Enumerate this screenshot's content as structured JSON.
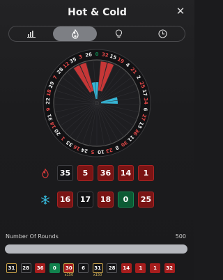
{
  "header": {
    "title": "Hot & Cold",
    "close_icon": "close-icon"
  },
  "tabs": [
    {
      "name": "stats",
      "icon": "bar-chart-icon",
      "active": false
    },
    {
      "name": "hot-cold",
      "icon": "fire-ice-icon",
      "active": true
    },
    {
      "name": "tips",
      "icon": "lightbulb-icon",
      "active": false
    },
    {
      "name": "history",
      "icon": "clock-icon",
      "active": false
    }
  ],
  "wheel": {
    "numbers": [
      "0",
      "32",
      "15",
      "19",
      "4",
      "21",
      "2",
      "25",
      "17",
      "34",
      "6",
      "27",
      "13",
      "36",
      "11",
      "30",
      "8",
      "23",
      "10",
      "5",
      "24",
      "16",
      "33",
      "1",
      "20",
      "14",
      "31",
      "9",
      "22",
      "18",
      "29",
      "7",
      "28",
      "12",
      "35",
      "3",
      "26"
    ],
    "hot": [
      "32",
      "15",
      "35",
      "3"
    ],
    "cold": [
      "17",
      "34",
      "26",
      "0"
    ]
  },
  "hot": {
    "icon": "fire-icon",
    "numbers": [
      {
        "n": "35",
        "c": "black"
      },
      {
        "n": "5",
        "c": "red"
      },
      {
        "n": "36",
        "c": "red"
      },
      {
        "n": "14",
        "c": "red"
      },
      {
        "n": "1",
        "c": "red"
      }
    ]
  },
  "cold": {
    "icon": "snowflake-icon",
    "numbers": [
      {
        "n": "16",
        "c": "red"
      },
      {
        "n": "17",
        "c": "black"
      },
      {
        "n": "18",
        "c": "red"
      },
      {
        "n": "0",
        "c": "green"
      },
      {
        "n": "25",
        "c": "red"
      }
    ]
  },
  "rounds": {
    "label": "Number Of Rounds",
    "value": "500"
  },
  "history": [
    {
      "n": "31",
      "c": "black",
      "outlined": true,
      "mult": ""
    },
    {
      "n": "28",
      "c": "black",
      "outlined": false,
      "mult": ""
    },
    {
      "n": "36",
      "c": "red",
      "outlined": false,
      "mult": ""
    },
    {
      "n": "0",
      "c": "green",
      "outlined": false,
      "mult": ""
    },
    {
      "n": "30",
      "c": "red",
      "outlined": true,
      "mult": "x150"
    },
    {
      "n": "6",
      "c": "black",
      "outlined": false,
      "mult": ""
    },
    {
      "n": "31",
      "c": "black",
      "outlined": true,
      "mult": "x150"
    },
    {
      "n": "28",
      "c": "black",
      "outlined": false,
      "mult": ""
    },
    {
      "n": "14",
      "c": "red",
      "outlined": false,
      "mult": ""
    },
    {
      "n": "1",
      "c": "red",
      "outlined": false,
      "mult": ""
    },
    {
      "n": "1",
      "c": "red",
      "outlined": false,
      "mult": ""
    },
    {
      "n": "32",
      "c": "red",
      "outlined": false,
      "mult": ""
    }
  ],
  "colors": {
    "hot": "#d83a3a",
    "cold": "#38c4e8",
    "red": "#a61d1d",
    "green": "#11824d"
  }
}
